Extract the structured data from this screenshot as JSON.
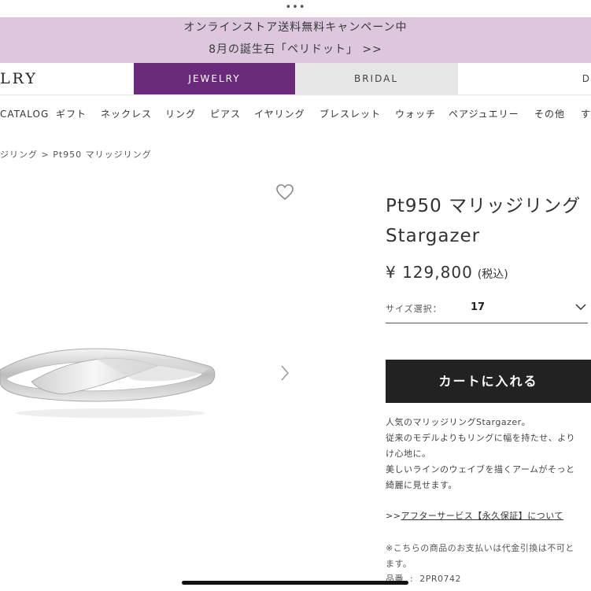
{
  "browser": {
    "dots": "•••"
  },
  "promo": {
    "line1": "オンラインストア送料無料キャンペーン中",
    "line2": "8月の誕生石「ペリドット」 >>"
  },
  "header": {
    "logo": "LRY",
    "tabs": [
      {
        "label": "JEWELRY",
        "active": true
      },
      {
        "label": "BRIDAL",
        "active": false
      },
      {
        "label": "D",
        "active": false
      }
    ]
  },
  "category_nav": [
    "CATALOG",
    "ギフト",
    "ネックレス",
    "リング",
    "ピアス",
    "イヤリング",
    "ブレスレット",
    "ウォッチ",
    "ペアジュエリー",
    "その他",
    "す"
  ],
  "breadcrumb": "ジリング > Pt950 マリッジリング",
  "product": {
    "title_line1": "Pt950 マリッジリング",
    "title_line2": "Stargazer",
    "price": "¥ 129,800",
    "tax": "(税込)",
    "size_label": "サイズ選択：",
    "size_value": "17",
    "cart_button": "カートに入れる",
    "description": [
      "人気のマリッジリングStargazer。",
      "従来のモデルよりもリングに幅を持たせ、より",
      "け心地に。",
      "美しいラインのウェイブを描くアームがそっと",
      "綺麗に見せます。"
    ],
    "after_prefix": ">>",
    "after_link": "アフターサービス【永久保証】について",
    "note_lines": [
      "※こちらの商品のお支払いは代金引換は不可と",
      "ます。"
    ],
    "code_label": "品番",
    "code_value": "2PR0742"
  },
  "colors": {
    "promo_bg": "#dcc7df",
    "jewelry_tab": "#6a2a7a",
    "bridal_tab": "#e6e6e6",
    "cart_button": "#222222"
  },
  "icons": [
    "heart-icon",
    "chevron-right-icon",
    "chevron-down-icon"
  ]
}
